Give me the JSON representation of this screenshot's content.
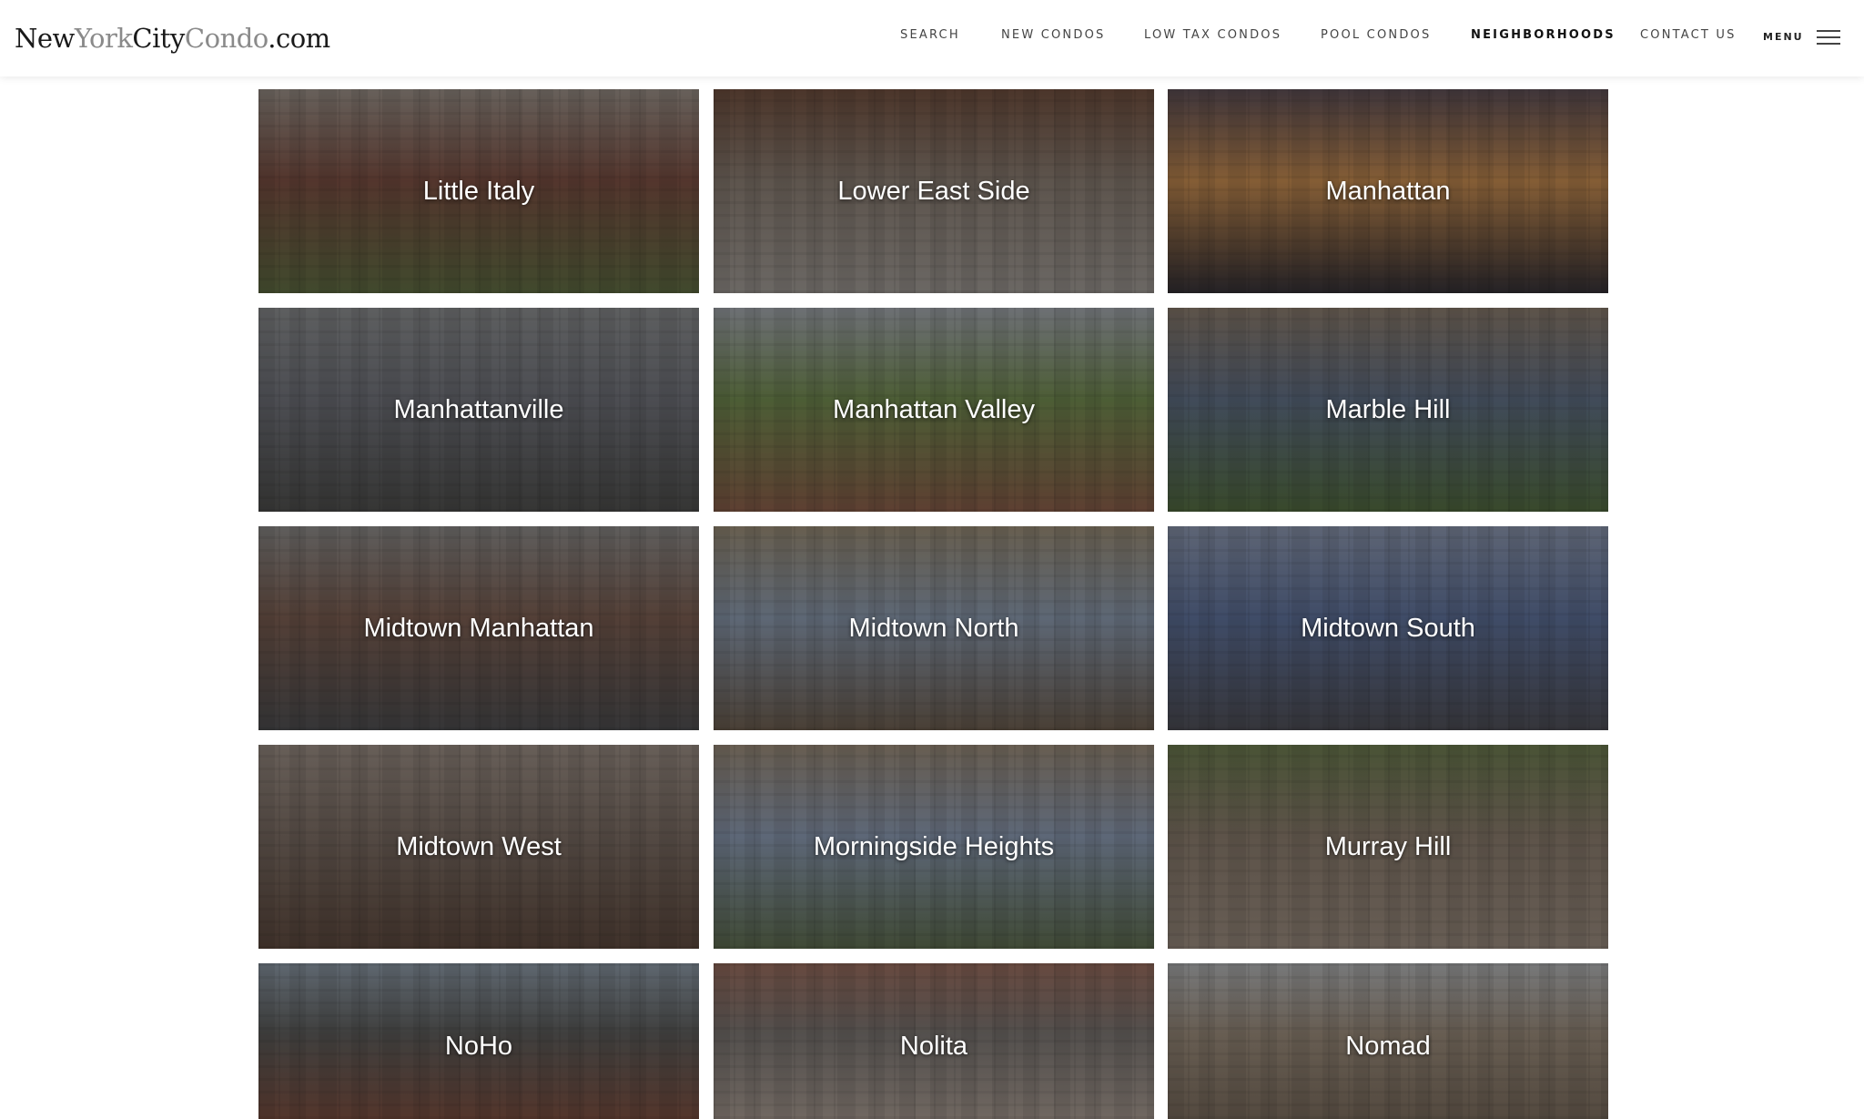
{
  "logo": {
    "part1": "New",
    "part2": "York",
    "part3": "City",
    "part4": "Condo",
    "part5": ".com"
  },
  "nav": {
    "items": [
      {
        "label": "SEARCH",
        "active": false
      },
      {
        "label": "NEW CONDOS",
        "active": false
      },
      {
        "label": "LOW TAX CONDOS",
        "active": false
      },
      {
        "label": "POOL CONDOS",
        "active": false
      },
      {
        "label": "NEIGHBORHOODS",
        "active": true
      },
      {
        "label": "CONTACT US",
        "active": false
      }
    ],
    "menu_label": "MENU"
  },
  "neighborhoods": [
    {
      "name": "Little Italy",
      "colors": [
        "#7a4a3c",
        "#9a8f86",
        "#5c6a3c"
      ]
    },
    {
      "name": "Lower East Side",
      "colors": [
        "#8a7c70",
        "#6e4a38",
        "#a09a94"
      ]
    },
    {
      "name": "Manhattan",
      "colors": [
        "#c98a4a",
        "#5a4a52",
        "#2e2a30"
      ]
    },
    {
      "name": "Manhattanville",
      "colors": [
        "#6e7078",
        "#8a8c8e",
        "#4a4a48"
      ]
    },
    {
      "name": "Manhattan Valley",
      "colors": [
        "#6f8a4a",
        "#a4a8b0",
        "#8a5a44"
      ]
    },
    {
      "name": "Marble Hill",
      "colors": [
        "#5c6c84",
        "#8a7a6a",
        "#4f6a3a"
      ]
    },
    {
      "name": "Midtown Manhattan",
      "colors": [
        "#7a5a4c",
        "#8c8a88",
        "#4a4a4c"
      ]
    },
    {
      "name": "Midtown North",
      "colors": [
        "#8a9ab0",
        "#9a8c74",
        "#6a5a4a"
      ]
    },
    {
      "name": "Midtown South",
      "colors": [
        "#5a6e9a",
        "#8a96b0",
        "#4a4a52"
      ]
    },
    {
      "name": "Midtown West",
      "colors": [
        "#7a6a60",
        "#9a8c82",
        "#5a4438"
      ]
    },
    {
      "name": "Morningside Heights",
      "colors": [
        "#8a9ab4",
        "#9a8a76",
        "#5a6a4a"
      ]
    },
    {
      "name": "Murray Hill",
      "colors": [
        "#8a7a6a",
        "#6a7a4a",
        "#9a8a7c"
      ]
    },
    {
      "name": "NoHo",
      "colors": [
        "#5a5a58",
        "#8c9aa8",
        "#7a4a3a"
      ]
    },
    {
      "name": "Nolita",
      "colors": [
        "#7a7470",
        "#9a6a5a",
        "#a89a90"
      ]
    },
    {
      "name": "Nomad",
      "colors": [
        "#9a8a78",
        "#b4b6b8",
        "#7a6a5a"
      ]
    }
  ]
}
